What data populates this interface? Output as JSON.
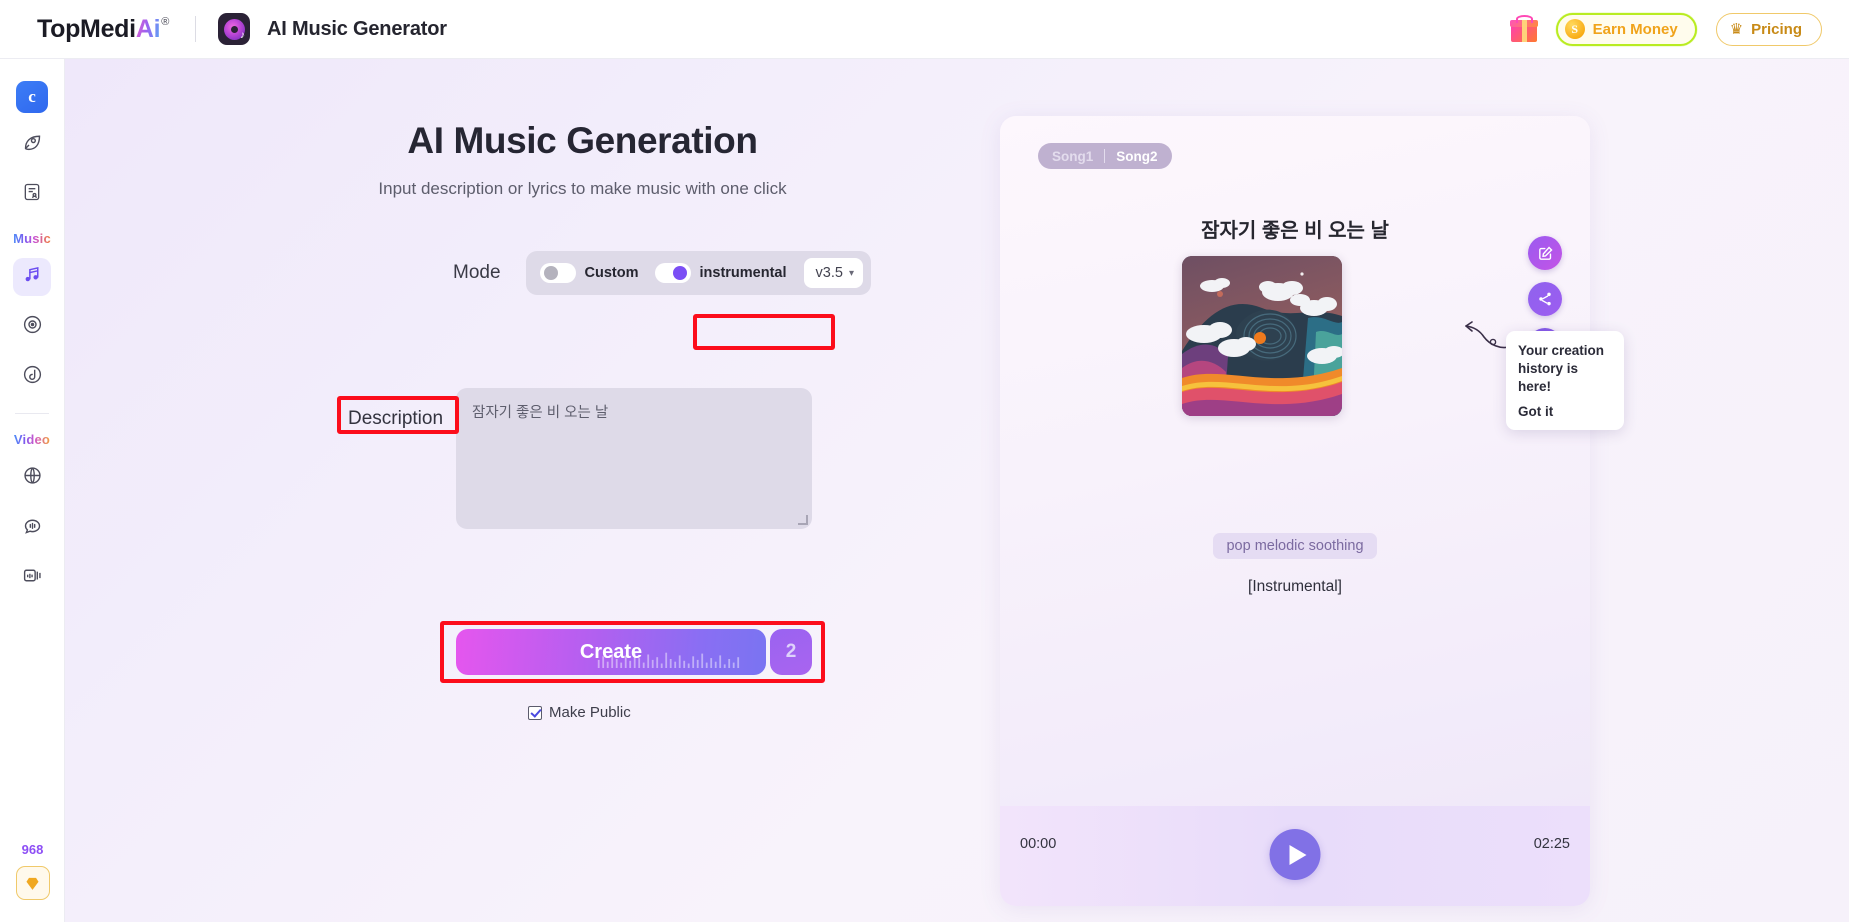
{
  "header": {
    "brand_top": "TopMedi",
    "brand_ai": "Ai",
    "brand_reg": "®",
    "app_icon_name": "music-disc-icon",
    "app_title": "AI Music Generator",
    "gift_icon": "gift-icon",
    "earn_money_label": "Earn Money",
    "earn_money_coin": "S",
    "pricing_label": "Pricing",
    "crown_icon": "crown-icon",
    "accent_green": "#b9ec21",
    "accent_gold": "#f0a31b"
  },
  "sidebar": {
    "logo_label": "c",
    "group_music": "Music",
    "group_video": "Video",
    "credits": "968",
    "items": [
      {
        "name": "sidebar-item-ai-tools",
        "icon": "leaf-edit-icon"
      },
      {
        "name": "sidebar-item-document",
        "icon": "document-person-icon"
      },
      {
        "name": "sidebar-item-music-generator",
        "icon": "music-note-icon",
        "active": true
      },
      {
        "name": "sidebar-item-record",
        "icon": "vinyl-record-icon"
      },
      {
        "name": "sidebar-item-audio-fx",
        "icon": "sound-swirl-icon"
      },
      {
        "name": "sidebar-item-video-globe",
        "icon": "globe-video-icon"
      },
      {
        "name": "sidebar-item-talking-avatar",
        "icon": "speech-bubble-icon"
      },
      {
        "name": "sidebar-item-video-library",
        "icon": "video-stack-icon"
      }
    ],
    "diamond_icon": "diamond-icon"
  },
  "main": {
    "title": "AI Music Generation",
    "subtitle": "Input description or lyrics to make music with one click",
    "mode": {
      "label": "Mode",
      "custom_label": "Custom",
      "custom_on": false,
      "instrumental_label": "instrumental",
      "instrumental_on": true,
      "version": "v3.5",
      "version_chevron": "chevron-down-icon"
    },
    "description": {
      "label": "Description",
      "value": "잠자기 좋은 비 오는 날",
      "placeholder": "잠자기 좋은 비 오는 날"
    },
    "create": {
      "label": "Create",
      "count": "2"
    },
    "make_public": {
      "label": "Make Public",
      "checked": true
    }
  },
  "right_panel": {
    "tabs": [
      {
        "label": "Song1",
        "active": false
      },
      {
        "label": "Song2",
        "active": true
      }
    ],
    "tab_separator": "|",
    "song_title": "잠자기 좋은 비 오는 날",
    "album_art_alt": "wave-mountain-album-art",
    "tag": "pop melodic soothing",
    "instrumental_note": "[Instrumental]",
    "rail": [
      {
        "name": "edit-icon"
      },
      {
        "name": "share-icon"
      },
      {
        "name": "sound-wave-icon"
      },
      {
        "name": "unlock-icon"
      }
    ],
    "tooltip": {
      "text": "Your creation history is here!",
      "button": "Got it"
    },
    "player": {
      "current_time": "00:00",
      "total_time": "02:25",
      "play_icon": "play-icon"
    }
  }
}
